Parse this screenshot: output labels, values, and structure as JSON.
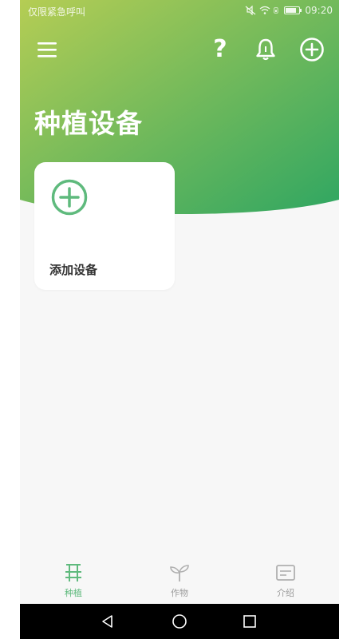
{
  "status_bar": {
    "carrier_text": "仅限紧急呼叫",
    "time": "09:20",
    "icons": [
      "mute-icon",
      "wifi-icon",
      "sim-icon",
      "battery-icon"
    ]
  },
  "toolbar": {
    "menu_icon": "menu-icon",
    "help_label": "?",
    "bell_icon": "bell-icon",
    "add_icon": "plus-circle-icon"
  },
  "page": {
    "title": "种植设备"
  },
  "add_device_card": {
    "label": "添加设备",
    "icon": "plus-circle-icon"
  },
  "bottom_nav": {
    "items": [
      {
        "label": "种植",
        "icon": "planter-icon",
        "active": true
      },
      {
        "label": "作物",
        "icon": "sprout-icon",
        "active": false
      },
      {
        "label": "介绍",
        "icon": "document-icon",
        "active": false
      }
    ]
  },
  "system_nav": {
    "buttons": [
      "back-icon",
      "home-icon",
      "recent-apps-icon"
    ]
  },
  "colors": {
    "gradient_start": "#b5cd54",
    "gradient_end": "#2fa662",
    "accent_green": "#5fba7d",
    "inactive_gray": "#b0b0b0",
    "background": "#f7f7f7",
    "card": "#ffffff"
  }
}
